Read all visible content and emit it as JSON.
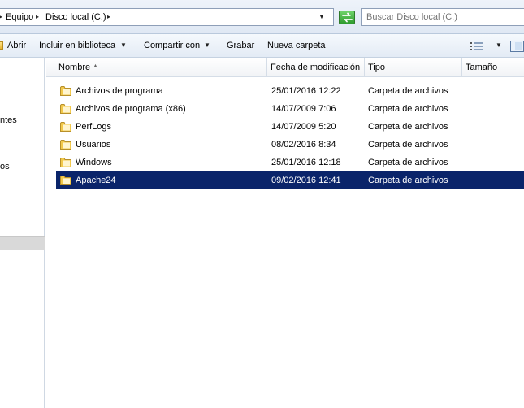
{
  "address_bar": {
    "breadcrumbs": [
      "Equipo",
      "Disco local (C:)"
    ],
    "search_placeholder": "Buscar Disco local (C:)"
  },
  "toolbar": {
    "items": [
      {
        "label": "Abrir",
        "has_dropdown": false
      },
      {
        "label": "Incluir en biblioteca",
        "has_dropdown": true
      },
      {
        "label": "Compartir con",
        "has_dropdown": true
      },
      {
        "label": "Grabar",
        "has_dropdown": false
      },
      {
        "label": "Nueva carpeta",
        "has_dropdown": false
      }
    ]
  },
  "nav_pane": {
    "partial_items": [
      "ntes",
      "os"
    ]
  },
  "columns": {
    "name": "Nombre",
    "date": "Fecha de modificación",
    "type": "Tipo",
    "size": "Tamaño"
  },
  "files": [
    {
      "name": "Archivos de programa",
      "date": "25/01/2016 12:22",
      "type": "Carpeta de archivos",
      "selected": false
    },
    {
      "name": "Archivos de programa (x86)",
      "date": "14/07/2009 7:06",
      "type": "Carpeta de archivos",
      "selected": false
    },
    {
      "name": "PerfLogs",
      "date": "14/07/2009 5:20",
      "type": "Carpeta de archivos",
      "selected": false
    },
    {
      "name": "Usuarios",
      "date": "08/02/2016 8:34",
      "type": "Carpeta de archivos",
      "selected": false
    },
    {
      "name": "Windows",
      "date": "25/01/2016 12:18",
      "type": "Carpeta de archivos",
      "selected": false
    },
    {
      "name": "Apache24",
      "date": "09/02/2016 12:41",
      "type": "Carpeta de archivos",
      "selected": true
    }
  ],
  "colors": {
    "selection": "#0a246a",
    "folder": "#f2c94c"
  },
  "icons": [
    "refresh-icon",
    "folder-icon",
    "views-icon",
    "preview-pane-icon",
    "chevron-down-icon"
  ]
}
